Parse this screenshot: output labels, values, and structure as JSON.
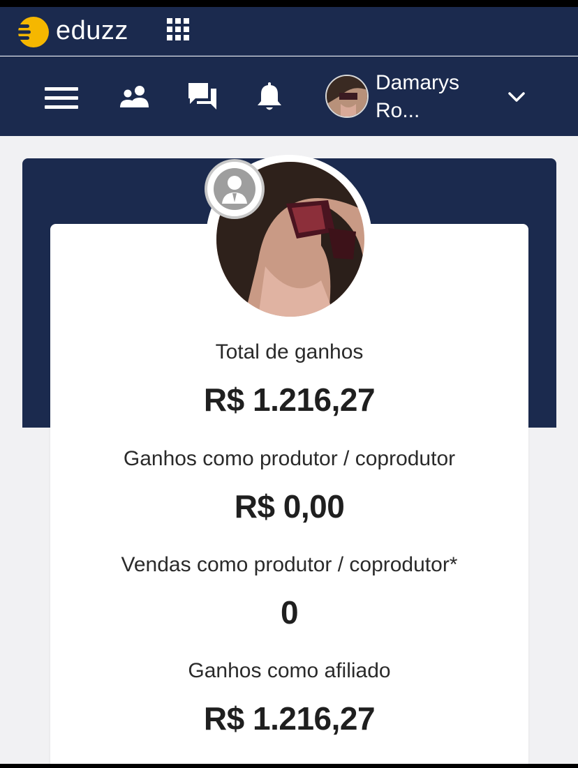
{
  "brand": {
    "name": "eduzz",
    "accent_color": "#f5b700",
    "bar_color": "#1b2a4e"
  },
  "header": {
    "icons": [
      "menu-icon",
      "users-icon",
      "chat-icon",
      "bell-icon"
    ],
    "user_name_line1": "Damarys",
    "user_name_line2": "Ro..."
  },
  "stats": [
    {
      "label": "Total de ganhos",
      "value": "R$ 1.216,27"
    },
    {
      "label": "Ganhos como produtor / coprodutor",
      "value": "R$ 0,00"
    },
    {
      "label": "Vendas como produtor / coprodutor*",
      "value": "0"
    },
    {
      "label": "Ganhos como afiliado",
      "value": "R$ 1.216,27"
    }
  ]
}
